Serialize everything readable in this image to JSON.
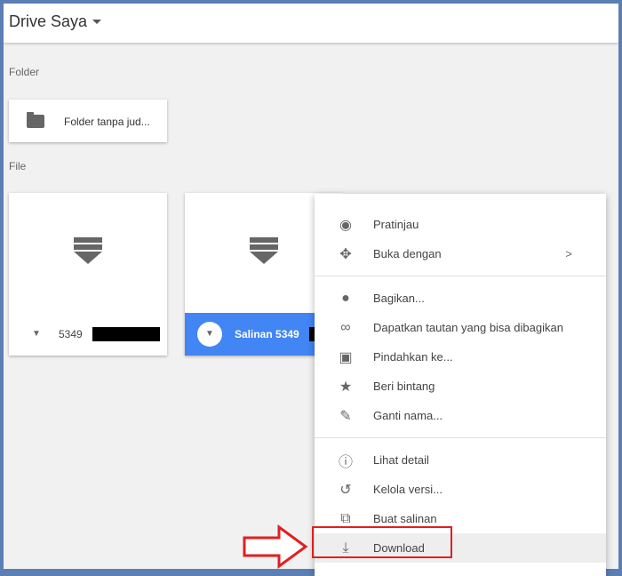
{
  "header": {
    "title": "Drive Saya"
  },
  "sections": {
    "folder": "Folder",
    "file": "File"
  },
  "folders": [
    {
      "name": "Folder tanpa jud..."
    }
  ],
  "files": [
    {
      "name": "5349"
    },
    {
      "name": "Salinan 5349"
    }
  ],
  "menu": {
    "items": [
      {
        "label": "Pratinjau",
        "icon": "eye-icon"
      },
      {
        "label": "Buka dengan",
        "icon": "open-with-icon",
        "submenu": ">"
      },
      {
        "label": "Bagikan...",
        "icon": "person-add-icon"
      },
      {
        "label": "Dapatkan tautan yang bisa dibagikan",
        "icon": "link-icon"
      },
      {
        "label": "Pindahkan ke...",
        "icon": "move-folder-icon"
      },
      {
        "label": "Beri bintang",
        "icon": "star-icon"
      },
      {
        "label": "Ganti nama...",
        "icon": "rename-icon"
      },
      {
        "label": "Lihat detail",
        "icon": "info-icon"
      },
      {
        "label": "Kelola versi...",
        "icon": "history-icon"
      },
      {
        "label": "Buat salinan",
        "icon": "copy-icon"
      },
      {
        "label": "Download",
        "icon": "download-icon"
      }
    ]
  },
  "colors": {
    "accent": "#4285f4",
    "highlight": "#e02020"
  }
}
